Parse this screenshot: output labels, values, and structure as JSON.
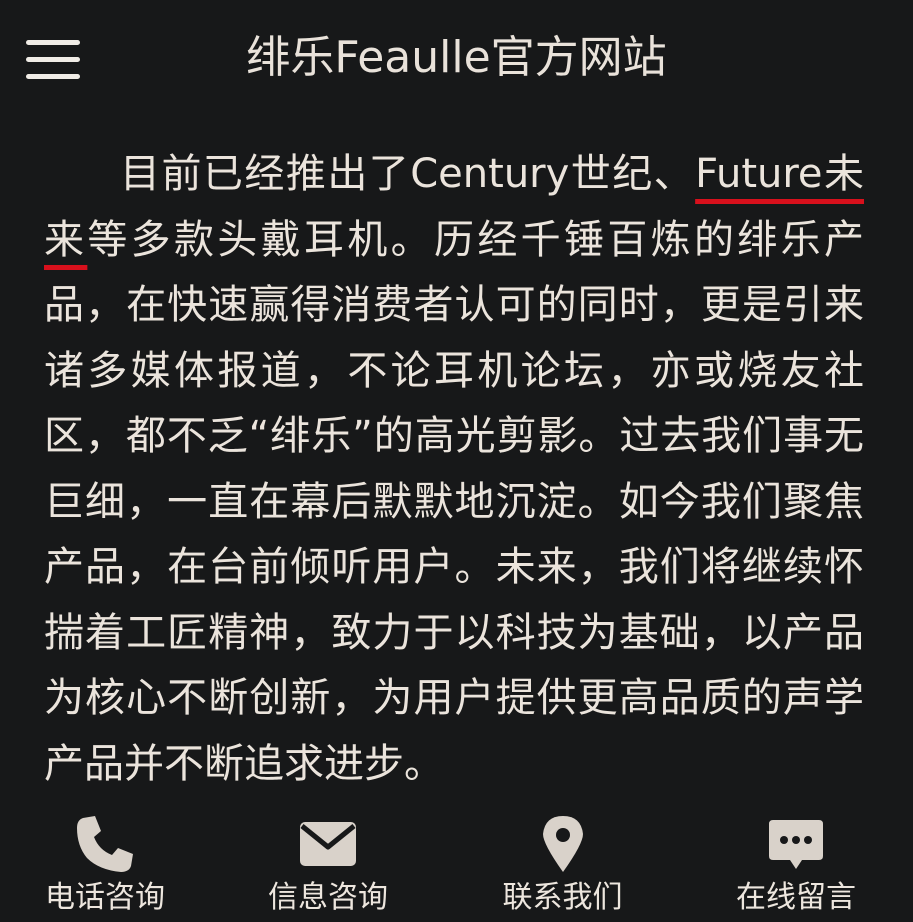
{
  "header": {
    "title": "绯乐Feaulle官方网站"
  },
  "article": {
    "before_mark": "目前已经推出了Century世纪、",
    "mark": "Future未来",
    "after_mark": "等多款头戴耳机。历经千锤百炼的绯乐产品，在快速赢得消费者认可的同时，更是引来诸多媒体报道，不论耳机论坛，亦或烧友社区，都不乏“绯乐”的高光剪影。过去我们事无巨细，一直在幕后默默地沉淀。如今我们聚焦产品，在台前倾听用户。未来，我们将继续怀揣着工匠精神，致力于以科技为基础，以产品为核心不断创新，为用户提供更高品质的声学产品并不断追求进步。",
    "underline_color": "#d8101c"
  },
  "bottom_nav": {
    "items": [
      {
        "label": "电话咨询",
        "icon": "phone-icon"
      },
      {
        "label": "信息咨询",
        "icon": "envelope-icon"
      },
      {
        "label": "联系我们",
        "icon": "map-pin-icon"
      },
      {
        "label": "在线留言",
        "icon": "chat-bubble-icon"
      }
    ]
  },
  "colors": {
    "background": "#171819",
    "text": "#ebe4dc",
    "icon": "#d9d2ca"
  }
}
